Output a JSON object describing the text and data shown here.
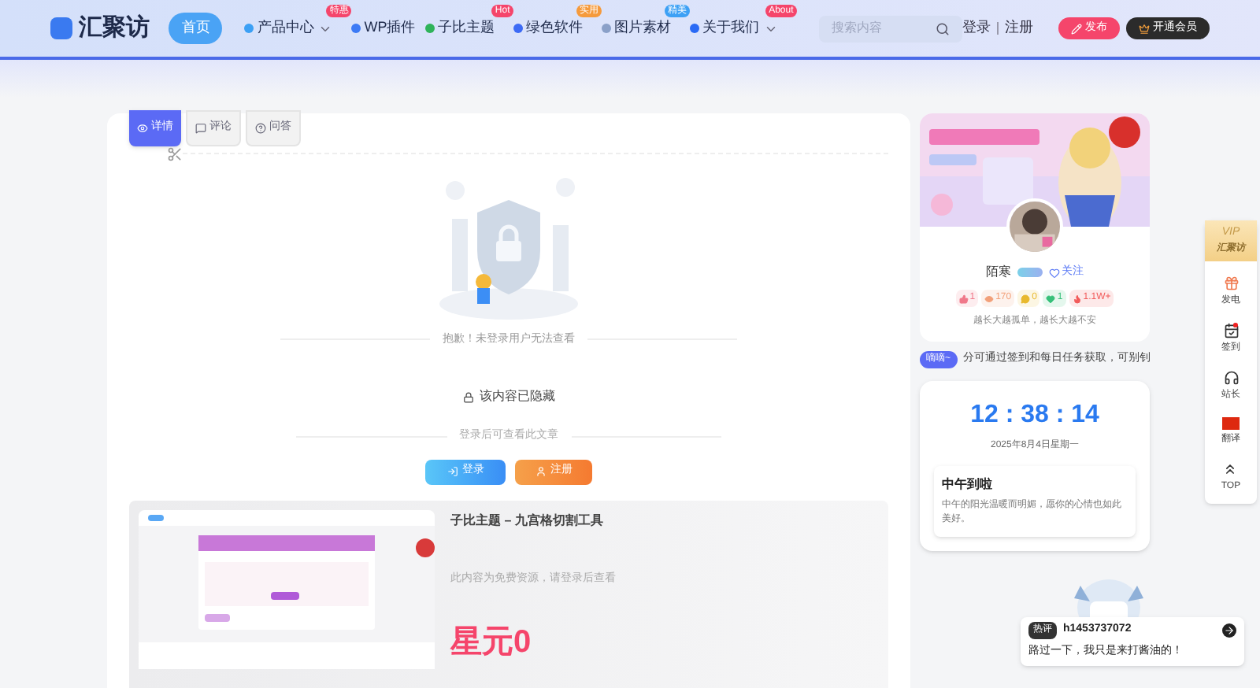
{
  "header": {
    "logo_text": "汇聚访",
    "nav": [
      {
        "label": "首页",
        "selected": true
      },
      {
        "label": "产品中心",
        "selected": false,
        "badge": "特惠",
        "color": "#f5456b",
        "dropdown": true
      },
      {
        "label": "WP插件",
        "selected": false
      },
      {
        "label": "子比主题",
        "selected": false,
        "badge": "Hot",
        "color": "#f5456b"
      },
      {
        "label": "绿色软件",
        "selected": false,
        "badge": "实用",
        "color": "#f59a3c"
      },
      {
        "label": "图片素材",
        "selected": false,
        "badge": "精美",
        "color": "#3ca0f5"
      },
      {
        "label": "关于我们",
        "selected": false,
        "badge": "About",
        "color": "#f5456b",
        "dropdown": true
      }
    ],
    "search": {
      "placeholder": "搜索内容"
    },
    "login": "登录",
    "register": "注册",
    "publish": "发布",
    "vip": "开通会员"
  },
  "article": {
    "tabs": [
      {
        "label": "详情",
        "selected": true
      },
      {
        "label": "评论",
        "selected": false
      },
      {
        "label": "问答",
        "selected": false
      }
    ],
    "notice": "抱歉！未登录用户无法查看",
    "hidden_label": "该内容已隐藏",
    "login_hint": "登录后可查看此文章",
    "buttons": [
      {
        "kind": "login",
        "label": "登录"
      },
      {
        "kind": "register",
        "label": "注册"
      }
    ],
    "product": {
      "title": "子比主题 – 九宫格切割工具",
      "note": "此内容为免费资源，请登录后查看",
      "price": "星元0"
    }
  },
  "profile": {
    "name": "陌寒",
    "follow": "关注",
    "stats": [
      {
        "kind": "like",
        "value": "1",
        "color": "#f0788a"
      },
      {
        "kind": "view",
        "value": "170",
        "color": "#f2a07a"
      },
      {
        "kind": "comment",
        "value": "0",
        "color": "#e8b92e"
      },
      {
        "kind": "fan",
        "value": "1",
        "color": "#36c07a"
      },
      {
        "kind": "hot",
        "value": "1.1W+",
        "color": "#f25a5a"
      }
    ],
    "motto": "越长大越孤单，越长大越不安"
  },
  "ticker": {
    "badge": "嘀嘀~",
    "text": "分可通过签到和每日任务获取，可别钊"
  },
  "clock": {
    "time": "12 : 38 : 14",
    "date": "2025年8月4日星期一",
    "greeting": "中午到啦",
    "message": "中午的阳光温暖而明媚，愿你的心情也如此美好。"
  },
  "toolbar": {
    "vip_top": "VIP",
    "vip_bottom": "汇聚访",
    "items": [
      {
        "kind": "gift",
        "label": "发电",
        "dot": false
      },
      {
        "kind": "checkin",
        "label": "签到",
        "dot": true
      },
      {
        "kind": "support",
        "label": "站长",
        "dot": false
      },
      {
        "kind": "translate",
        "label": "翻译",
        "dot": false
      },
      {
        "kind": "top",
        "label": "TOP",
        "dot": false
      }
    ]
  },
  "hot_comment": {
    "tag": "热评",
    "user": "h1453737072",
    "text": "路过一下，我只是来打酱油的！"
  }
}
